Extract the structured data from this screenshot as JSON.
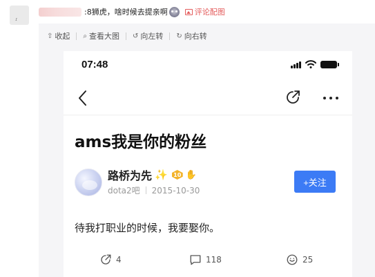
{
  "comment": {
    "separator": ":",
    "text": "8狮虎，啥时候去提亲啊",
    "image_comment_label": "评论配图",
    "accent_color": "#e35a5a"
  },
  "toolbar": {
    "items": [
      {
        "icon": "collapse-up-icon",
        "label": "收起"
      },
      {
        "icon": "search-icon",
        "label": "查看大图"
      },
      {
        "icon": "rotate-left-icon",
        "label": "向左转"
      },
      {
        "icon": "rotate-right-icon",
        "label": "向右转"
      }
    ]
  },
  "phone": {
    "status_time": "07:48",
    "post": {
      "title": "ams我是你的粉丝",
      "author": {
        "name": "路桥为先",
        "level": "10",
        "forum": "dota2吧",
        "date": "2015-10-30"
      },
      "follow_label": "+关注",
      "follow_color": "#3c7bf5",
      "body": "待我打职业的时候，我要娶你。",
      "stats": {
        "shares": "4",
        "comments": "118",
        "likes": "25"
      }
    }
  }
}
